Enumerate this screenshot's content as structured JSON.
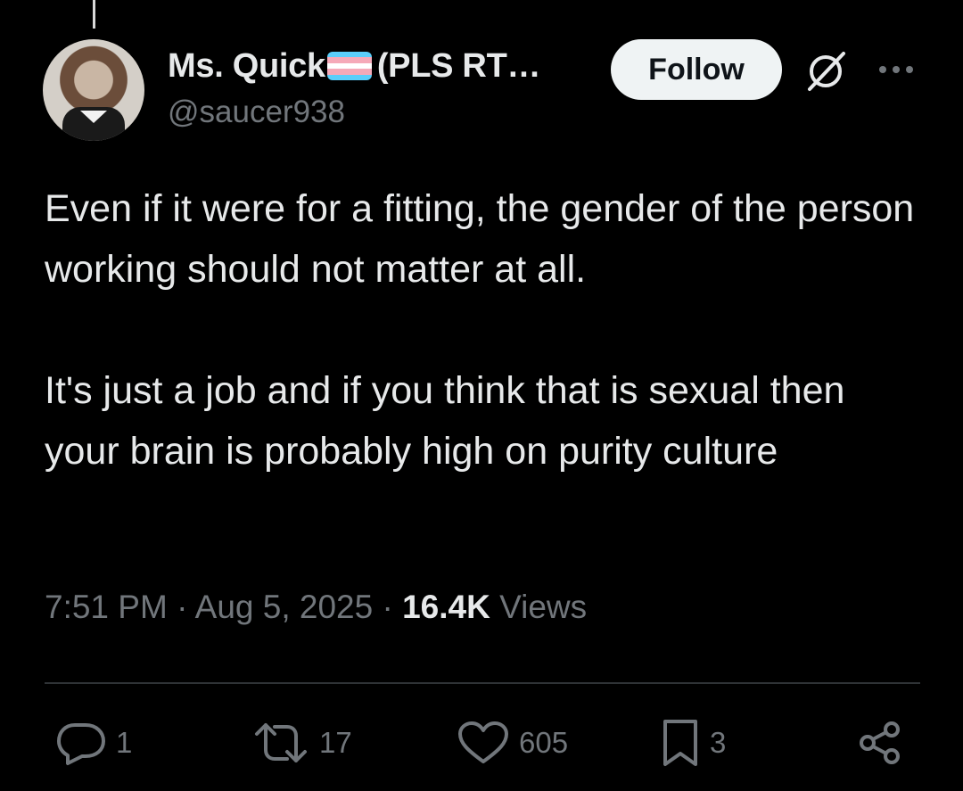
{
  "author": {
    "name_prefix": "Ms. Quick",
    "name_suffix": "(PLS RT…",
    "handle": "@saucer938",
    "flag_colors": [
      "#5bcefa",
      "#f5a9b8",
      "#ffffff",
      "#f5a9b8",
      "#5bcefa"
    ]
  },
  "header": {
    "follow_label": "Follow",
    "grok_icon": "grok-icon",
    "more_icon": "more-icon"
  },
  "tweet": {
    "paragraphs": [
      "Even if it were for a fitting, the gender of the person working should not matter at all.",
      "It's just a job and if you think that is sexual then your brain is probably high on purity culture"
    ],
    "time": "7:51 PM",
    "date": "Aug 5, 2025",
    "views_count": "16.4K",
    "views_label": "Views"
  },
  "actions": {
    "replies": "1",
    "reposts": "17",
    "likes": "605",
    "bookmarks": "3"
  },
  "colors": {
    "background": "#000000",
    "text": "#e7e9ea",
    "muted": "#71767b",
    "divider": "#2f3336"
  }
}
